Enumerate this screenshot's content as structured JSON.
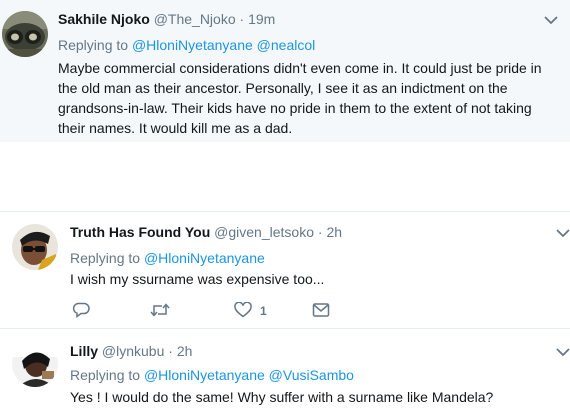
{
  "tweets": [
    {
      "name": "Sakhile Njoko",
      "handle": "@The_Njoko",
      "separator": "·",
      "time": "19m",
      "replying_to_label": "Replying to",
      "mentions": [
        "@HloniNyetanyane",
        "@nealcol"
      ],
      "lines": [
        "Maybe commercial considerations didn't even come in. It could just be pride in",
        "the old man as their ancestor. Personally, I see it as an indictment on the",
        "grandsons-in-law. Their kids have no pride in them to the extent of not taking",
        "their names. It would kill me as a dad."
      ]
    },
    {
      "name": "Truth Has Found You",
      "handle": "@given_letsoko",
      "separator": "·",
      "time": "2h",
      "replying_to_label": "Replying to",
      "mentions": [
        "@HloniNyetanyane"
      ],
      "lines": [
        "I wish my ssurname was expensive too..."
      ],
      "actions": {
        "reply_count": "",
        "retweet_count": "",
        "like_count": "1"
      }
    },
    {
      "name": "Lilly",
      "handle": "@lynkubu",
      "separator": "·",
      "time": "2h",
      "replying_to_label": "Replying to",
      "mentions": [
        "@HloniNyetanyane",
        "@VusiSambo"
      ],
      "lines": [
        "Yes ! I would do the same! Why suffer with a surname like Mandela?"
      ]
    }
  ],
  "colors": {
    "link": "#1b95e0",
    "secondary_text": "#657786",
    "highlight_bg": "#f5f8fa",
    "divider": "#e6ecf0"
  },
  "icons": [
    "chevron-down-icon",
    "reply-icon",
    "retweet-icon",
    "like-icon",
    "direct-message-icon"
  ]
}
